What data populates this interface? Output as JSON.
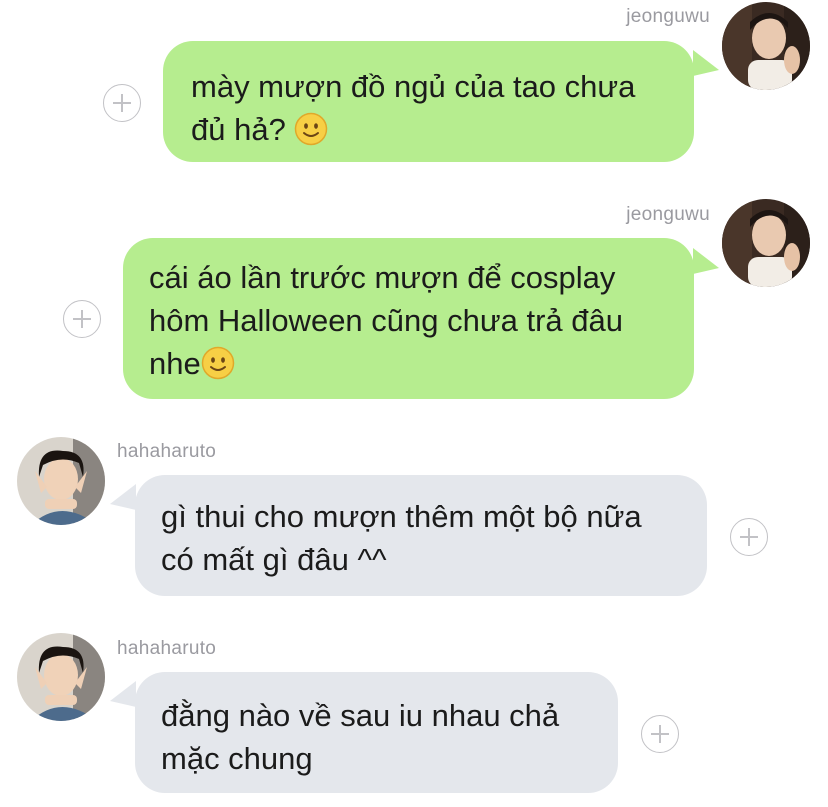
{
  "colors": {
    "outgoing_bubble": "#b6ed8f",
    "incoming_bubble": "#e4e7ec",
    "username": "#9a9aa0",
    "add_button": "#c2c2c6"
  },
  "messages": [
    {
      "direction": "outgoing",
      "sender": "jeonguwu",
      "lines": [
        "mày mượn đồ ngủ của tao chưa",
        "đủ hả?"
      ],
      "emoji": "slightly-smiling-face"
    },
    {
      "direction": "outgoing",
      "sender": "jeonguwu",
      "lines": [
        "cái áo lần trước mượn để cosplay",
        "hôm Halloween cũng chưa trả đâu",
        "nhe"
      ],
      "emoji": "slightly-smiling-face"
    },
    {
      "direction": "incoming",
      "sender": "hahaharuto",
      "lines": [
        "gì thui cho mượn thêm một bộ nữa",
        "có mất gì đâu ^^"
      ]
    },
    {
      "direction": "incoming",
      "sender": "hahaharuto",
      "lines": [
        "đằng nào về sau iu nhau chả",
        "mặc chung"
      ]
    }
  ]
}
